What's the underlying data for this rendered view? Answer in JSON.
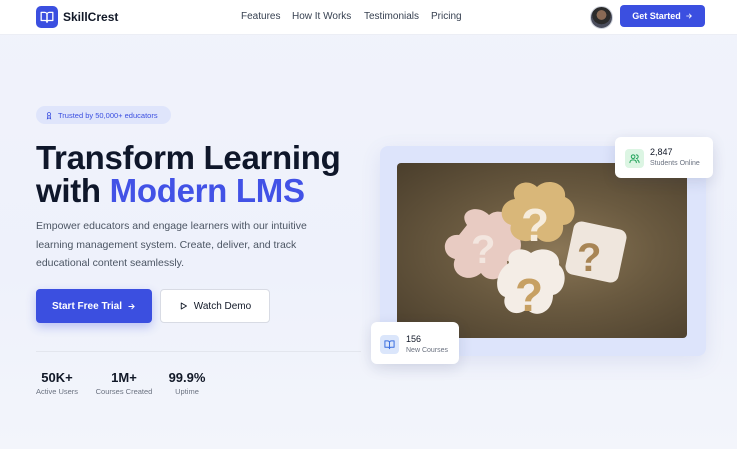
{
  "nav": {
    "brand": "SkillCrest",
    "links": [
      "Features",
      "How It Works",
      "Testimonials",
      "Pricing"
    ],
    "cta": "Get Started"
  },
  "hero": {
    "badge": "Trusted by 50,000+ educators",
    "title_line1": "Transform Learning",
    "title_line2_plain": "with",
    "title_line2_accent": "Modern LMS",
    "subtitle": "Empower educators and engage learners with our intuitive learning management system. Create, deliver, and track educational content seamlessly.",
    "primary_button": "Start Free Trial",
    "secondary_button": "Watch Demo",
    "stats": [
      {
        "value": "50K+",
        "label": "Active Users"
      },
      {
        "value": "1M+",
        "label": "Courses Created"
      },
      {
        "value": "99.9%",
        "label": "Uptime"
      }
    ]
  },
  "cards": {
    "students": {
      "value": "2,847",
      "label": "Students Online",
      "icon": "users-icon"
    },
    "courses": {
      "value": "156",
      "label": "New Courses",
      "icon": "book-icon"
    }
  },
  "colors": {
    "accent": "#3b4fe0",
    "accent_text": "#4252e6",
    "heading": "#0f172a"
  }
}
